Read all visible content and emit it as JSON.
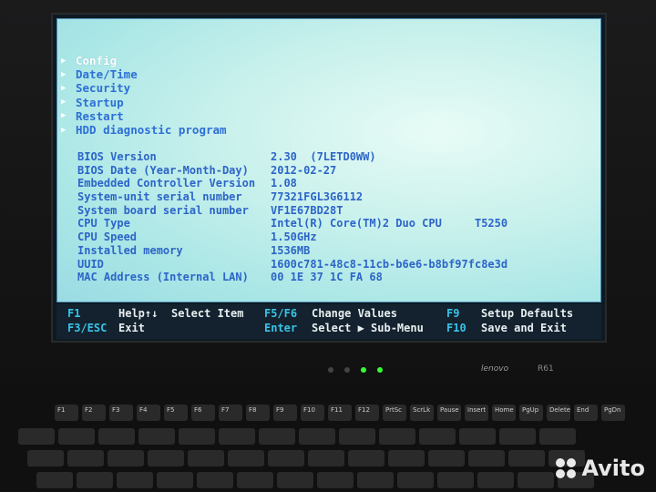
{
  "menu": [
    {
      "label": "Config",
      "selected": true
    },
    {
      "label": "Date/Time"
    },
    {
      "label": "Security"
    },
    {
      "label": "Startup"
    },
    {
      "label": "Restart"
    },
    {
      "label": "HDD diagnostic program"
    }
  ],
  "info": [
    {
      "label": "BIOS Version",
      "value": "2.30  (7LETD0WW)"
    },
    {
      "label": "BIOS Date (Year-Month-Day)",
      "value": "2012-02-27"
    },
    {
      "label": "Embedded Controller Version",
      "value": "1.08"
    },
    {
      "label": "System-unit serial number",
      "value": "77321FGL3G6112"
    },
    {
      "label": "System board serial number",
      "value": "VF1E67BD28T"
    },
    {
      "label": "CPU Type",
      "value": "Intel(R) Core(TM)2 Duo CPU     T5250"
    },
    {
      "label": "CPU Speed",
      "value": "1.50GHz"
    },
    {
      "label": "Installed memory",
      "value": "1536MB"
    },
    {
      "label": "UUID",
      "value": "1600c781-48c8-11cb-b6e6-b8bf97fc8e3d"
    },
    {
      "label": "MAC Address (Internal LAN)",
      "value": "00 1E 37 1C FA 68"
    }
  ],
  "footer": {
    "f1": "F1",
    "help": "Help↑↓",
    "select_item": "Select Item",
    "f3": "F3/ESC",
    "exit": "Exit",
    "f5": "F5/F6",
    "change_values": "Change Values",
    "enter": "Enter",
    "select_sub": "Select ▶ Sub-Menu",
    "f9": "F9",
    "setup_defaults": "Setup Defaults",
    "f10": "F10",
    "save_exit": "Save and Exit"
  },
  "laptop": {
    "brand": "lenovo",
    "model": "R61"
  },
  "keys": [
    "F1",
    "F2",
    "F3",
    "F4",
    "F5",
    "F6",
    "F7",
    "F8",
    "F9",
    "F10",
    "F11",
    "F12",
    "PrtSc",
    "ScrLk",
    "Pause",
    "Insert",
    "Home",
    "PgUp",
    "Delete",
    "End",
    "PgDn"
  ],
  "watermark": "Avito"
}
